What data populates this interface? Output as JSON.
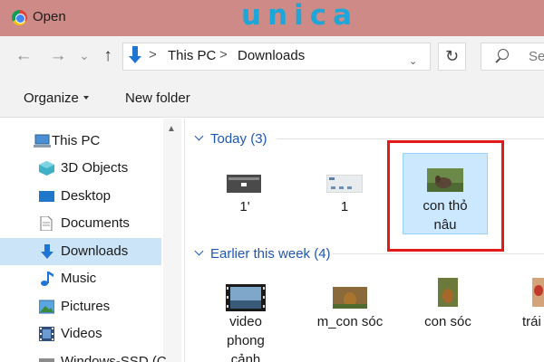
{
  "window": {
    "title": "Open",
    "brand": "unica"
  },
  "nav": {
    "back_glyph": "←",
    "forward_glyph": "→",
    "history_glyph": "⌄",
    "up_glyph": "↑",
    "breadcrumb": [
      "This PC",
      "Downloads"
    ],
    "separator": ">",
    "dropdown_glyph": "⌄",
    "refresh_glyph": "↻",
    "search_placeholder": "Sea"
  },
  "commands": {
    "organize": "Organize",
    "new_folder": "New folder"
  },
  "sidebar": {
    "items": [
      {
        "label": "This PC",
        "icon": "computer-icon"
      },
      {
        "label": "3D Objects",
        "icon": "cube-icon"
      },
      {
        "label": "Desktop",
        "icon": "desktop-icon"
      },
      {
        "label": "Documents",
        "icon": "document-icon"
      },
      {
        "label": "Downloads",
        "icon": "download-icon",
        "selected": true
      },
      {
        "label": "Music",
        "icon": "music-note-icon"
      },
      {
        "label": "Pictures",
        "icon": "picture-icon"
      },
      {
        "label": "Videos",
        "icon": "film-icon"
      },
      {
        "label": "Windows-SSD (C",
        "icon": "drive-icon"
      }
    ]
  },
  "groups": {
    "today": {
      "label": "Today (3)",
      "files": [
        {
          "name": "1'"
        },
        {
          "name": "1"
        },
        {
          "name_line1": "con thỏ",
          "name_line2": "nâu",
          "selected": true
        }
      ]
    },
    "earlier": {
      "label": "Earlier this week (4)",
      "files": [
        {
          "name_line1": "video",
          "name_line2": "phong",
          "name_line3": "cảnh"
        },
        {
          "name": "m_con sóc"
        },
        {
          "name": "con sóc"
        },
        {
          "name": "trái"
        }
      ]
    }
  },
  "colors": {
    "titlebar": "#cd8a86",
    "brand": "#1ea6d8",
    "selection": "#cce8ff",
    "highlight": "#e31a1a",
    "group_header": "#1e57b4"
  }
}
